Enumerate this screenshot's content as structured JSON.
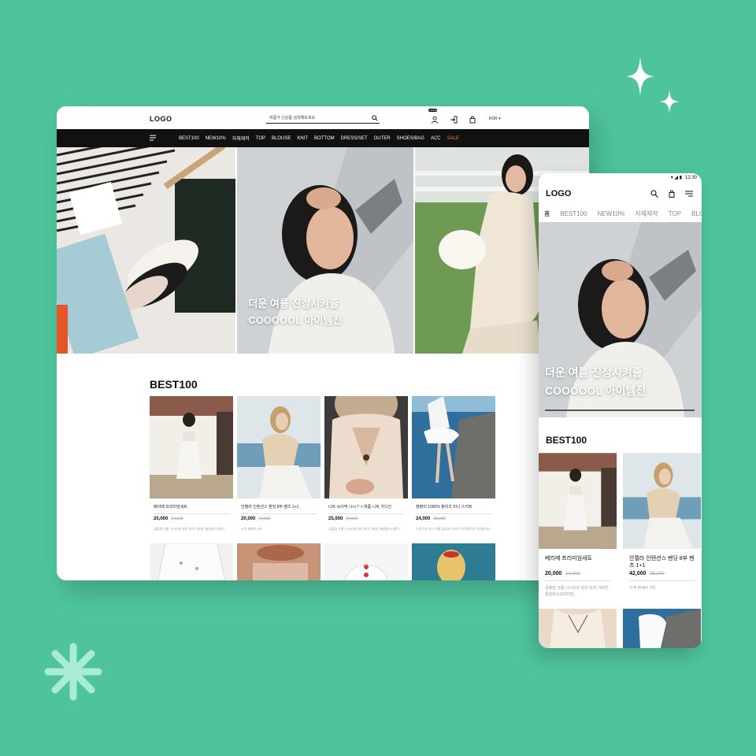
{
  "colors": {
    "background": "#4fc49c",
    "nav_bg": "#111111",
    "sale": "#ff7a2a"
  },
  "desktop": {
    "logo": "LOGO",
    "search_placeholder": "여름가 신상품 검색해보세요",
    "login_badge": "LOGIN",
    "lang": "KOR",
    "nav": [
      "BEST100",
      "NEW10%",
      "자체제작",
      "TOP",
      "BLOUSE",
      "KNIT",
      "BOTTOM",
      "DRESS/SET",
      "OUTER",
      "SHOES/BAG",
      "ACC",
      "SALE"
    ],
    "hero": {
      "line1": "더운 여름 진정시켜줄",
      "line2": "COOOOOL 아이템전"
    },
    "section_title": "BEST100",
    "products": [
      {
        "name": "베리떼 프리미엄세트",
        "price": "20,000",
        "orig": "24,000",
        "desc": "심플한 크롭 나시티와 같은 비치 가버진 롱원피스(세트)"
      },
      {
        "name": "안젤라 인텐션스 밴딩 8부 팬츠 1+1",
        "price": "20,000",
        "orig": "24,000",
        "desc": "누적 판매수 1위"
      },
      {
        "name": "니트 브이넥 나시 T + 여름 니트 가디건",
        "price": "25,000",
        "orig": "29,000",
        "desc": "심플한 크롭 나시티와 같은 비치 가버진 롱원피스(세트)"
      },
      {
        "name": "청량의 1000% 플리츠 미니 스커트",
        "price": "24,000",
        "orig": "28,000",
        "desc": "소장가치 있는 여름 플리츠 스커트 아이템으로 추천합니다"
      }
    ]
  },
  "mobile": {
    "time": "12:30",
    "logo": "LOGO",
    "tabs": [
      "홈",
      "BEST100",
      "NEW10%",
      "자체제작",
      "TOP",
      "BLOUSE"
    ],
    "hero": {
      "line1": "더운 여름 진정시켜줄",
      "line2": "COOOOOL 아이템전"
    },
    "section_title": "BEST100",
    "products": [
      {
        "name": "베리떼 프리미엄세트",
        "price": "20,000",
        "orig": "24,000",
        "desc": "심플한 크롭 나시티와 같은 비치 가버진 롱원피스(GOOD)"
      },
      {
        "name": "안젤라 인텐션스 밴딩 8부 팬츠 1+1",
        "price": "42,000",
        "orig": "55,000",
        "desc": "누적 판매수 1위"
      }
    ]
  }
}
